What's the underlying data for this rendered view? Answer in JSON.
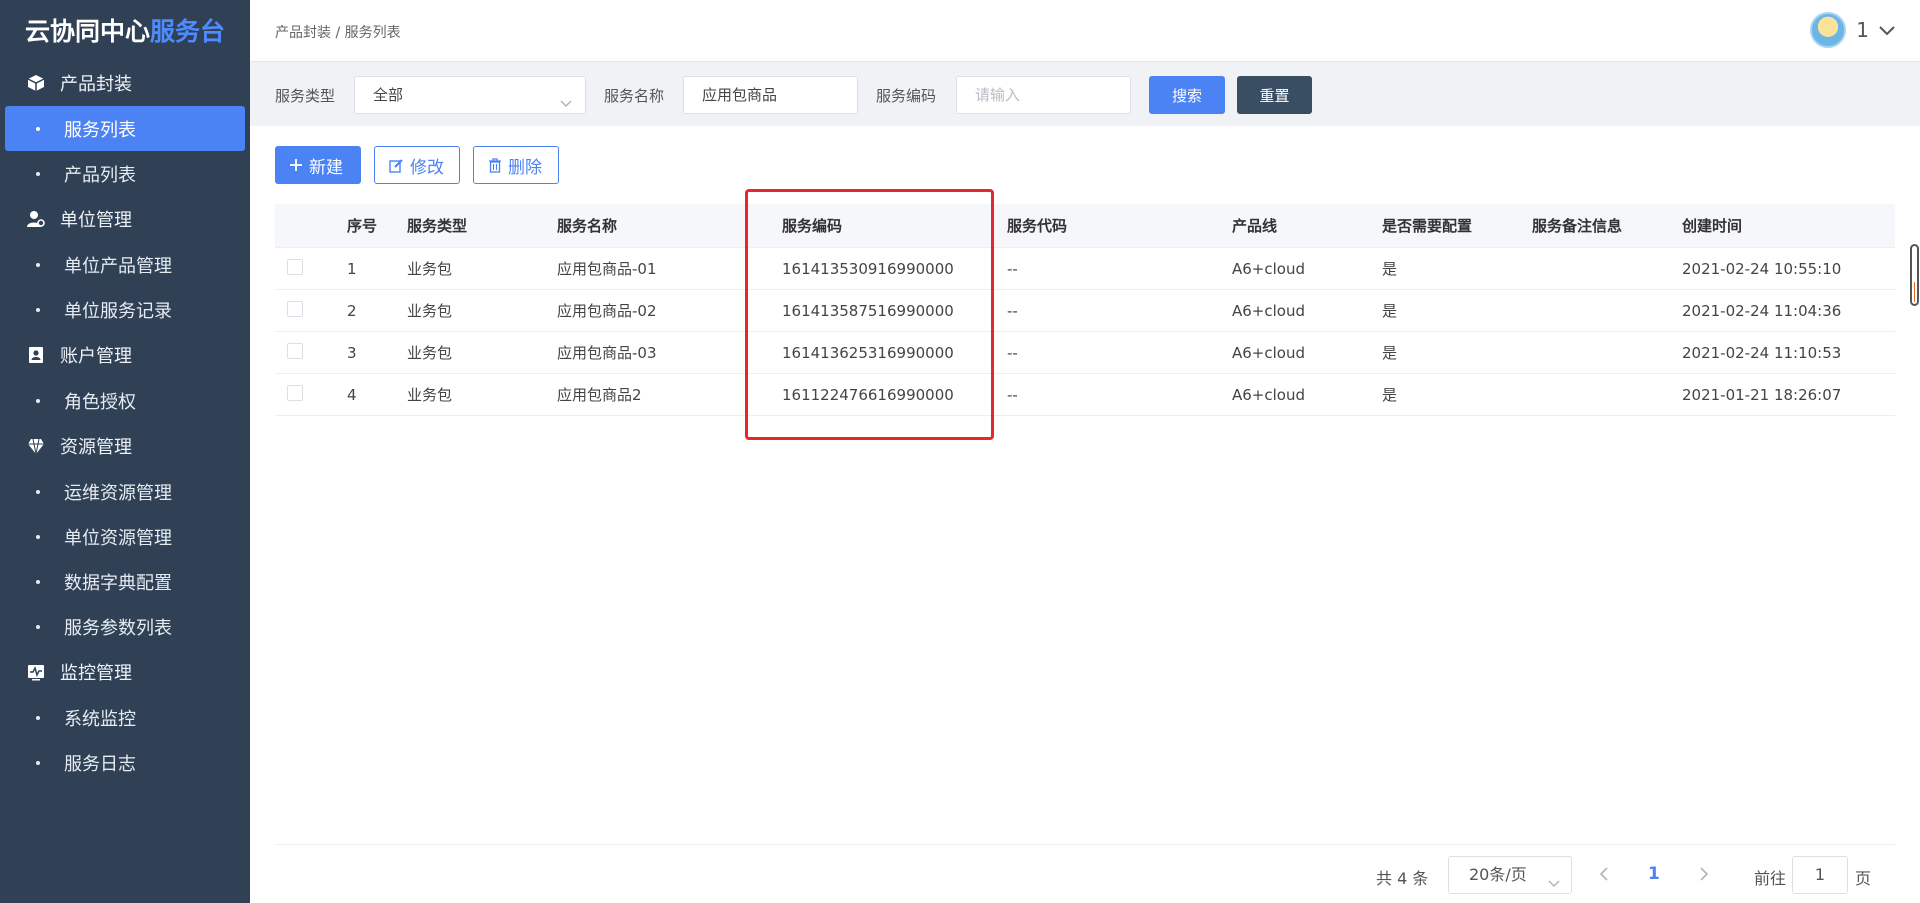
{
  "app": {
    "brand_a": "云协同中心",
    "brand_b": "服务台"
  },
  "sidebar": {
    "groups": [
      {
        "label": "产品封装",
        "icon": "cube-icon",
        "items": [
          {
            "label": "服务列表",
            "active": true
          },
          {
            "label": "产品列表"
          }
        ]
      },
      {
        "label": "单位管理",
        "icon": "user-gear-icon",
        "items": [
          {
            "label": "单位产品管理"
          },
          {
            "label": "单位服务记录"
          }
        ]
      },
      {
        "label": "账户管理",
        "icon": "id-badge-icon",
        "items": [
          {
            "label": "角色授权"
          }
        ]
      },
      {
        "label": "资源管理",
        "icon": "diamond-icon",
        "items": [
          {
            "label": "运维资源管理"
          },
          {
            "label": "单位资源管理"
          },
          {
            "label": "数据字典配置"
          },
          {
            "label": "服务参数列表"
          }
        ]
      },
      {
        "label": "监控管理",
        "icon": "monitor-pulse-icon",
        "items": [
          {
            "label": "系统监控"
          },
          {
            "label": "服务日志"
          }
        ]
      }
    ]
  },
  "header": {
    "breadcrumb": "产品封装 / 服务列表",
    "user_name": "1"
  },
  "filters": {
    "service_type_label": "服务类型",
    "service_type_value": "全部",
    "service_name_label": "服务名称",
    "service_name_value": "应用包商品",
    "service_code_label": "服务编码",
    "service_code_placeholder": "请输入",
    "search_label": "搜索",
    "reset_label": "重置"
  },
  "toolbar": {
    "new_label": "新建",
    "edit_label": "修改",
    "delete_label": "删除"
  },
  "table": {
    "headers": [
      "序号",
      "服务类型",
      "服务名称",
      "服务编码",
      "服务代码",
      "产品线",
      "是否需要配置",
      "服务备注信息",
      "创建时间"
    ],
    "rows": [
      [
        "1",
        "业务包",
        "应用包商品-01",
        "161413530916990000",
        "--",
        "A6+cloud",
        "是",
        "",
        "2021-02-24 10:55:10"
      ],
      [
        "2",
        "业务包",
        "应用包商品-02",
        "161413587516990000",
        "--",
        "A6+cloud",
        "是",
        "",
        "2021-02-24 11:04:36"
      ],
      [
        "3",
        "业务包",
        "应用包商品-03",
        "161413625316990000",
        "--",
        "A6+cloud",
        "是",
        "",
        "2021-02-24 11:10:53"
      ],
      [
        "4",
        "业务包",
        "应用包商品2",
        "161122476616990000",
        "--",
        "A6+cloud",
        "是",
        "",
        "2021-01-21 18:26:07"
      ]
    ]
  },
  "pagination": {
    "total_text": "共 4 条",
    "page_size": "20条/页",
    "current_page": "1",
    "goto_label": "前往",
    "goto_value": "1",
    "page_suffix": "页"
  },
  "colors": {
    "sidebar_bg": "#304156",
    "primary": "#4b83f5",
    "highlight_border": "#e8262c"
  }
}
